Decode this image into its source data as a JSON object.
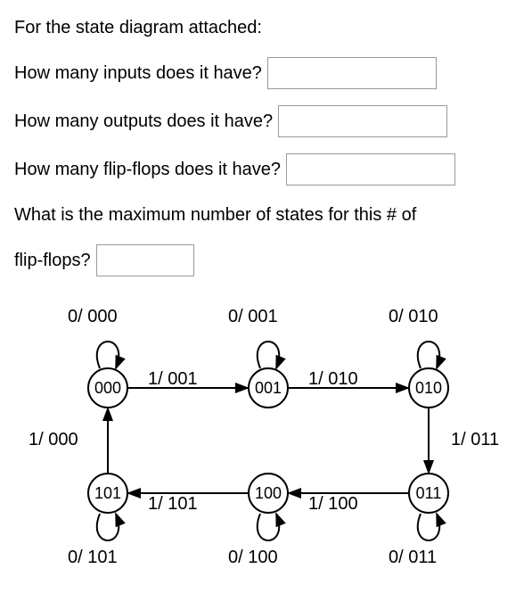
{
  "prompt_intro": "For the state diagram attached:",
  "q1": "How many inputs does it have?",
  "q2": "How many outputs does it have?",
  "q3": "How many flip-flops does it have?",
  "q4a": "What is the maximum number of states for this # of",
  "q4b": "flip-flops?",
  "states": {
    "s000": "000",
    "s001": "001",
    "s010": "010",
    "s011": "011",
    "s100": "100",
    "s101": "101"
  },
  "edges": {
    "e000_001": "1/ 001",
    "e001_010": "1/ 010",
    "e010_011": "1/ 011",
    "e011_100": "1/ 100",
    "e100_101": "1/ 101",
    "e101_000": "1/ 000",
    "loop000": "0/ 000",
    "loop001": "0/ 001",
    "loop010": "0/ 010",
    "loop011": "0/ 011",
    "loop100": "0/ 100",
    "loop101": "0/ 101"
  }
}
